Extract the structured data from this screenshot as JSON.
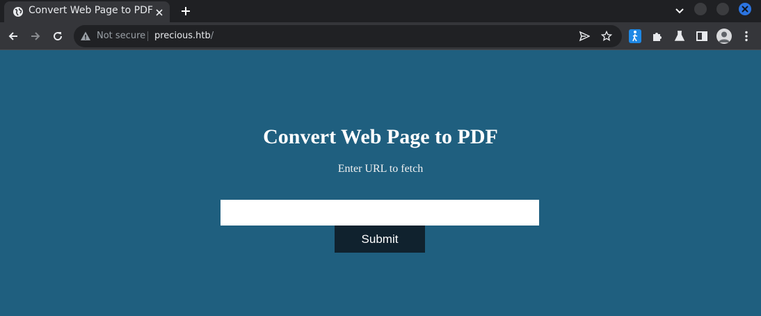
{
  "browser": {
    "tab": {
      "title": "Convert Web Page to PDF",
      "favicon": "globe-icon"
    },
    "address_bar": {
      "security_label": "Not secure",
      "host": "precious.htb",
      "path": "/"
    },
    "colors": {
      "tabstrip": "#1f2023",
      "toolbar": "#35363a",
      "omnibox": "#202124",
      "close_accent": "#2c74e0"
    }
  },
  "page": {
    "heading": "Convert Web Page to PDF",
    "subheading": "Enter URL to fetch",
    "url_input": {
      "value": "",
      "placeholder": ""
    },
    "submit_label": "Submit",
    "colors": {
      "background": "#1f5f7f",
      "button": "#10222e",
      "input": "#ffffff"
    }
  }
}
